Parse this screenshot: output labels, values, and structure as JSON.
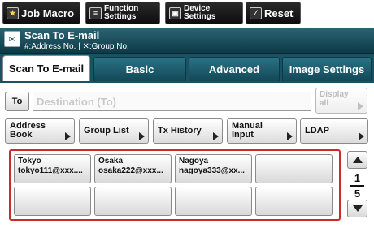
{
  "top_buttons": [
    {
      "label": "Job Macro",
      "icon": "star-icon"
    },
    {
      "label_line1": "Function",
      "label_line2": "Settings",
      "icon": "function-settings-icon"
    },
    {
      "label_line1": "Device",
      "label_line2": "Settings",
      "icon": "device-settings-icon"
    },
    {
      "label": "Reset",
      "icon": "reset-icon"
    }
  ],
  "header": {
    "title": "Scan To E-mail",
    "subtitle": "#:Address No. | ✕:Group No."
  },
  "tabs": [
    {
      "label": "Scan To E-mail",
      "active": true
    },
    {
      "label": "Basic",
      "active": false
    },
    {
      "label": "Advanced",
      "active": false
    },
    {
      "label": "Image Settings",
      "active": false
    }
  ],
  "to_button": {
    "label": "To"
  },
  "destination": {
    "placeholder": "Destination (To)"
  },
  "display_all": {
    "line1": "Display",
    "line2": "all",
    "enabled": false
  },
  "function_buttons": [
    {
      "line1": "Address",
      "line2": "Book"
    },
    {
      "label": "Group List"
    },
    {
      "label": "Tx History"
    },
    {
      "line1": "Manual",
      "line2": "Input"
    },
    {
      "label": "LDAP"
    }
  ],
  "address_cells": [
    {
      "name": "Tokyo",
      "email": "tokyo111@xxx...."
    },
    {
      "name": "Osaka",
      "email": "osaka222@xxx..."
    },
    {
      "name": "Nagoya",
      "email": "nagoya333@xx..."
    },
    {
      "name": "",
      "email": ""
    },
    {
      "name": "",
      "email": ""
    },
    {
      "name": "",
      "email": ""
    },
    {
      "name": "",
      "email": ""
    },
    {
      "name": "",
      "email": ""
    }
  ],
  "pager": {
    "current": "1",
    "total": "5"
  },
  "colors": {
    "teal": "#1a5264",
    "selection_border": "#cc2b2b"
  }
}
